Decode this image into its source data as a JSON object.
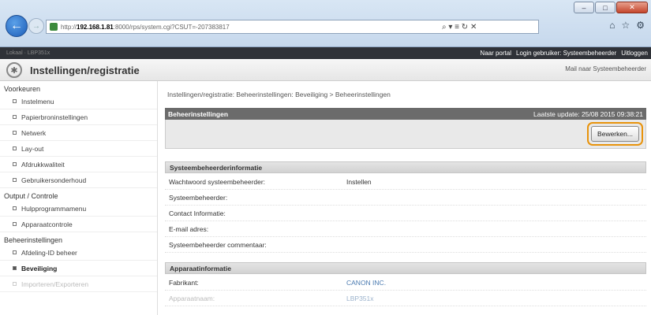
{
  "browser": {
    "url_prefix": "http://",
    "url_host": "192.168.1.81",
    "url_rest": ":8000/rps/system.cgi?CSUT=-207383817",
    "addr_tools": "⌕ ▾ ≡ ↻ ✕",
    "window_controls": [
      "–",
      "□",
      "✕"
    ]
  },
  "portal": {
    "left_text": "Lokaal · LBP351x",
    "portal_link": "Naar portal",
    "login_user": "Login gebruiker: Systeembeheerder",
    "logout": "Uitloggen"
  },
  "header": {
    "title": "Instellingen/registratie",
    "mail_link": "Mail naar Systeembeheerder"
  },
  "sidebar": {
    "groups": [
      {
        "label": "Voorkeuren",
        "items": [
          {
            "label": "Instelmenu"
          },
          {
            "label": "Papierbroninstellingen"
          },
          {
            "label": "Netwerk"
          },
          {
            "label": "Lay-out"
          },
          {
            "label": "Afdrukkwaliteit"
          },
          {
            "label": "Gebruikersonderhoud"
          }
        ]
      },
      {
        "label": "Output / Controle",
        "items": [
          {
            "label": "Hulpprogrammamenu"
          },
          {
            "label": "Apparaatcontrole"
          }
        ]
      },
      {
        "label": "Beheerinstellingen",
        "items": [
          {
            "label": "Afdeling-ID beheer"
          },
          {
            "label": "Beveiliging"
          },
          {
            "label": "Importeren/Exporteren"
          }
        ]
      }
    ]
  },
  "main": {
    "breadcrumb": "Instellingen/registratie: Beheerinstellingen: Beveiliging > Beheerinstellingen",
    "panel_title": "Beheerinstellingen",
    "last_update": "Laatste update: 25/08 2015 09:38:21",
    "edit_button": "Bewerken...",
    "section1": {
      "title": "Systeembeheerderinformatie",
      "rows": [
        {
          "label": "Wachtwoord systeembeheerder:",
          "value": "Instellen"
        },
        {
          "label": "Systeembeheerder:",
          "value": ""
        },
        {
          "label": "Contact Informatie:",
          "value": ""
        },
        {
          "label": "E-mail adres:",
          "value": ""
        },
        {
          "label": "Systeembeheerder commentaar:",
          "value": ""
        }
      ]
    },
    "section2": {
      "title": "Apparaatinformatie",
      "rows": [
        {
          "label": "Fabrikant:",
          "value": "CANON INC."
        },
        {
          "label": "Apparaatnaam:",
          "value": "LBP351x"
        }
      ]
    }
  }
}
